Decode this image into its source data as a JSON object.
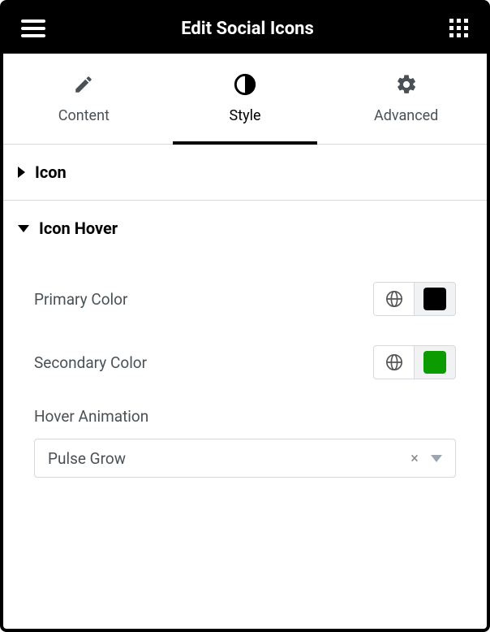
{
  "header": {
    "title": "Edit Social Icons"
  },
  "tabs": {
    "content": "Content",
    "style": "Style",
    "advanced": "Advanced"
  },
  "sections": {
    "icon": {
      "title": "Icon"
    },
    "iconHover": {
      "title": "Icon Hover",
      "primaryColor": {
        "label": "Primary Color",
        "swatch": "#000000"
      },
      "secondaryColor": {
        "label": "Secondary Color",
        "swatch": "#0c9b00"
      },
      "hoverAnimation": {
        "label": "Hover Animation",
        "value": "Pulse Grow"
      }
    }
  }
}
